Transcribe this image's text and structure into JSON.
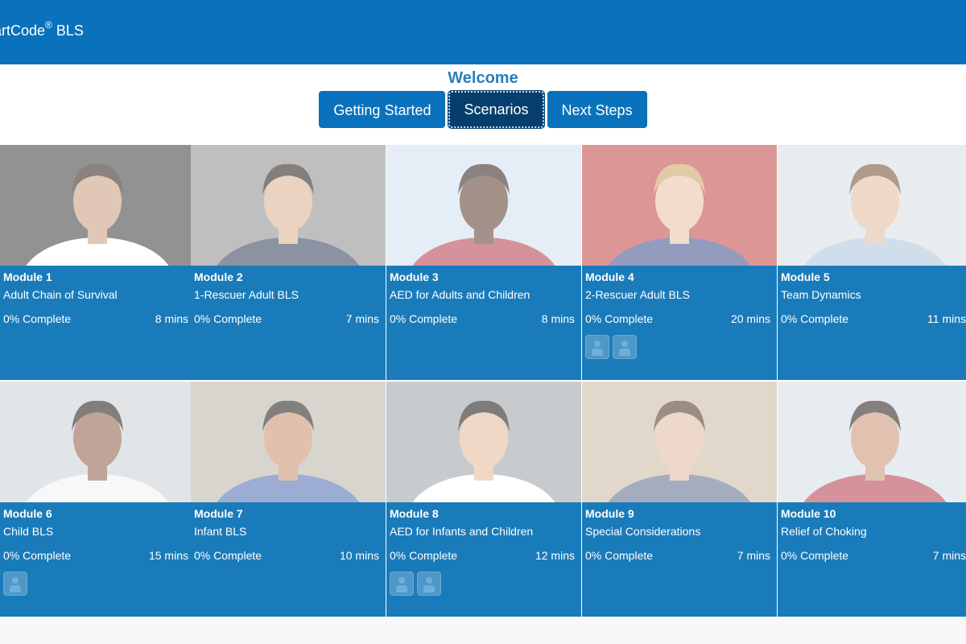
{
  "header": {
    "title": "artCode",
    "registered": "®",
    "title_suffix": " BLS",
    "color": "#0a72bc"
  },
  "welcome": "Welcome",
  "tabs": [
    {
      "label": "Getting Started",
      "active": false
    },
    {
      "label": "Scenarios",
      "active": true
    },
    {
      "label": "Next Steps",
      "active": false
    }
  ],
  "modules": [
    {
      "number": "Module 1",
      "title": "Adult Chain of Survival",
      "progress": "0% Complete",
      "duration": "8 mins",
      "badges": 0
    },
    {
      "number": "Module 2",
      "title": "1-Rescuer Adult BLS",
      "progress": "0% Complete",
      "duration": "7 mins",
      "badges": 0
    },
    {
      "number": "Module 3",
      "title": "AED for Adults and Children",
      "progress": "0% Complete",
      "duration": "8 mins",
      "badges": 0
    },
    {
      "number": "Module 4",
      "title": "2-Rescuer Adult BLS",
      "progress": "0% Complete",
      "duration": "20 mins",
      "badges": 2
    },
    {
      "number": "Module 5",
      "title": "Team Dynamics",
      "progress": "0% Complete",
      "duration": "11 mins",
      "badges": 0
    },
    {
      "number": "Module 6",
      "title": "Child BLS",
      "progress": "0% Complete",
      "duration": "15 mins",
      "badges": 1
    },
    {
      "number": "Module 7",
      "title": "Infant BLS",
      "progress": "0% Complete",
      "duration": "10 mins",
      "badges": 0
    },
    {
      "number": "Module 8",
      "title": "AED for Infants and Children",
      "progress": "0% Complete",
      "duration": "12 mins",
      "badges": 2
    },
    {
      "number": "Module 9",
      "title": "Special Considerations",
      "progress": "0% Complete",
      "duration": "7 mins",
      "badges": 0
    },
    {
      "number": "Module 10",
      "title": "Relief of Choking",
      "progress": "0% Complete",
      "duration": "7 mins",
      "badges": 0
    }
  ],
  "colors": {
    "card_info": "#1a7bba",
    "tab": "#0a72bc",
    "tab_active": "#063f6d",
    "welcome": "#2a7fb8"
  }
}
